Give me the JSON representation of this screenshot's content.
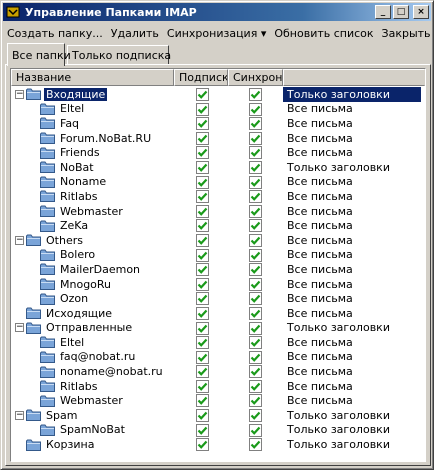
{
  "window": {
    "title": "Управление Папками IMAP",
    "minimize": "_",
    "maximize": "□",
    "close": "×"
  },
  "menu": [
    "Создать папку...",
    "Удалить",
    "Синхронизация ▾",
    "Обновить список",
    "Закрыть"
  ],
  "tabs": [
    "Все папки",
    "Только подписка"
  ],
  "columns": [
    "Название",
    "Подписка",
    "Синхрон...",
    ""
  ],
  "icons": {
    "folder": "folder-icon",
    "check": "checkmark-icon",
    "expand": "expander-icon"
  },
  "colors": {
    "selection": "#0a246a",
    "check_green": "#1a9a1a",
    "folder_blue": "#7aa4d8"
  },
  "folders": [
    {
      "name": "Входящие",
      "level": 0,
      "expander": "−",
      "subscribed": true,
      "sync": true,
      "mode": "Только заголовки",
      "selected": true
    },
    {
      "name": "Eltel",
      "level": 1,
      "expander": "",
      "subscribed": true,
      "sync": true,
      "mode": "Все письма"
    },
    {
      "name": "Faq",
      "level": 1,
      "expander": "",
      "subscribed": true,
      "sync": true,
      "mode": "Все письма"
    },
    {
      "name": "Forum.NoBat.RU",
      "level": 1,
      "expander": "",
      "subscribed": true,
      "sync": true,
      "mode": "Все письма"
    },
    {
      "name": "Friends",
      "level": 1,
      "expander": "",
      "subscribed": true,
      "sync": true,
      "mode": "Все письма"
    },
    {
      "name": "NoBat",
      "level": 1,
      "expander": "",
      "subscribed": true,
      "sync": true,
      "mode": "Только заголовки"
    },
    {
      "name": "Noname",
      "level": 1,
      "expander": "",
      "subscribed": true,
      "sync": true,
      "mode": "Все письма"
    },
    {
      "name": "Ritlabs",
      "level": 1,
      "expander": "",
      "subscribed": true,
      "sync": true,
      "mode": "Все письма"
    },
    {
      "name": "Webmaster",
      "level": 1,
      "expander": "",
      "subscribed": true,
      "sync": true,
      "mode": "Все письма"
    },
    {
      "name": "ZeKa",
      "level": 1,
      "expander": "",
      "subscribed": true,
      "sync": true,
      "mode": "Все письма"
    },
    {
      "name": "Others",
      "level": 0,
      "expander": "−",
      "subscribed": true,
      "sync": true,
      "mode": "Все письма"
    },
    {
      "name": "Bolero",
      "level": 1,
      "expander": "",
      "subscribed": true,
      "sync": true,
      "mode": "Все письма"
    },
    {
      "name": "MailerDaemon",
      "level": 1,
      "expander": "",
      "subscribed": true,
      "sync": true,
      "mode": "Все письма"
    },
    {
      "name": "MnogoRu",
      "level": 1,
      "expander": "",
      "subscribed": true,
      "sync": true,
      "mode": "Все письма"
    },
    {
      "name": "Ozon",
      "level": 1,
      "expander": "",
      "subscribed": true,
      "sync": true,
      "mode": "Все письма"
    },
    {
      "name": "Исходящие",
      "level": 0,
      "expander": "",
      "subscribed": true,
      "sync": true,
      "mode": "Все письма"
    },
    {
      "name": "Отправленные",
      "level": 0,
      "expander": "−",
      "subscribed": true,
      "sync": true,
      "mode": "Только заголовки"
    },
    {
      "name": "Eltel",
      "level": 1,
      "expander": "",
      "subscribed": true,
      "sync": true,
      "mode": "Все письма"
    },
    {
      "name": "faq@nobat.ru",
      "level": 1,
      "expander": "",
      "subscribed": true,
      "sync": true,
      "mode": "Все письма"
    },
    {
      "name": "noname@nobat.ru",
      "level": 1,
      "expander": "",
      "subscribed": true,
      "sync": true,
      "mode": "Все письма"
    },
    {
      "name": "Ritlabs",
      "level": 1,
      "expander": "",
      "subscribed": true,
      "sync": true,
      "mode": "Все письма"
    },
    {
      "name": "Webmaster",
      "level": 1,
      "expander": "",
      "subscribed": true,
      "sync": true,
      "mode": "Все письма"
    },
    {
      "name": "Spam",
      "level": 0,
      "expander": "−",
      "subscribed": true,
      "sync": true,
      "mode": "Только заголовки"
    },
    {
      "name": "SpamNoBat",
      "level": 1,
      "expander": "",
      "subscribed": true,
      "sync": true,
      "mode": "Только заголовки"
    },
    {
      "name": "Корзина",
      "level": 0,
      "expander": "",
      "subscribed": true,
      "sync": true,
      "mode": "Только заголовки"
    }
  ]
}
